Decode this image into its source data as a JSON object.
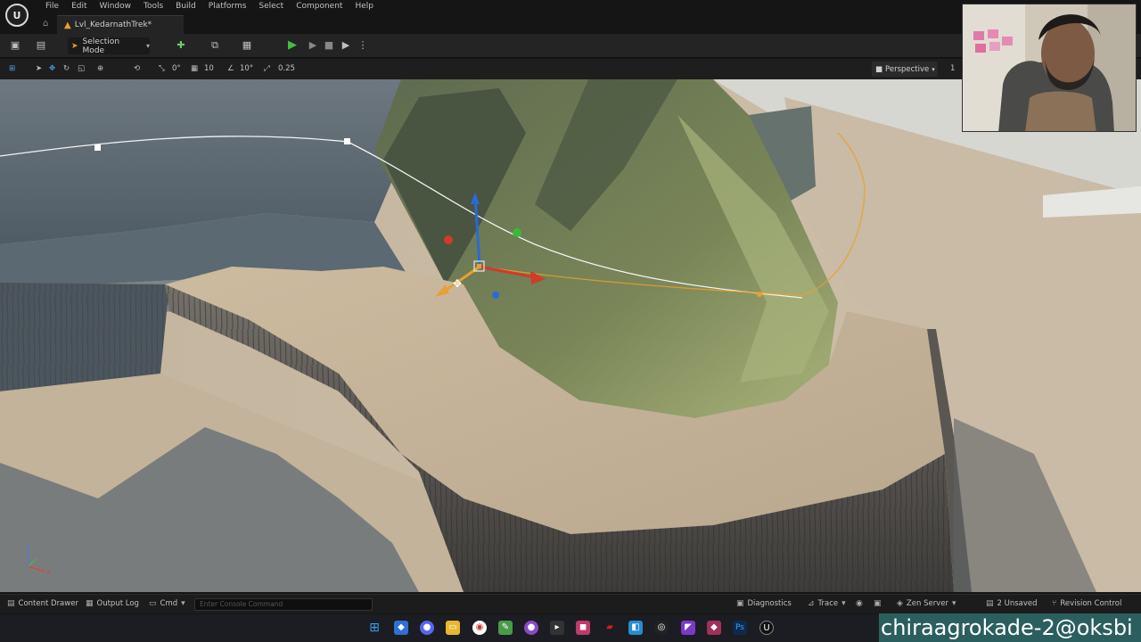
{
  "menubar": {
    "logo": "ue-logo",
    "items": [
      "File",
      "Edit",
      "Window",
      "Tools",
      "Build",
      "Platforms",
      "Select",
      "Component",
      "Help"
    ]
  },
  "tabs": {
    "level_tab": "Lvl_KedarnathTrek*"
  },
  "toolbar": {
    "mode_label": "Selection Mode",
    "icons": [
      "save-icon",
      "content-browser-icon",
      "add-actor-icon",
      "blueprint-icon",
      "cinematics-icon",
      "play-icon",
      "step-icon",
      "stop-icon",
      "launch-icon",
      "more-icon"
    ]
  },
  "viewport_toolbar": {
    "snap_rotation_grid": "0°",
    "grid_size": "10",
    "rotation_snap": "10°",
    "scale_snap": "0.25",
    "perspective_label": "Perspective",
    "fov_label": "1"
  },
  "viewport": {
    "axis_z": "z",
    "axis_x": "x"
  },
  "statusbar": {
    "content_drawer": "Content Drawer",
    "output_log": "Output Log",
    "cmd": "Cmd",
    "console_placeholder": "Enter Console Command",
    "diagnostics": "Diagnostics",
    "trace": "Trace",
    "zen_server": "Zen Server",
    "unsaved": "2 Unsaved",
    "revision_control": "Revision Control"
  },
  "taskbar": {
    "watermark": "chiraagrokade-2@oksbi"
  },
  "colors": {
    "accent_orange": "#e8a030",
    "play_green": "#3ec43e",
    "gizmo_red": "#d23a2a",
    "gizmo_blue": "#2a6ad8",
    "gizmo_green": "#3ab83a",
    "spline_orange": "#e8a030"
  }
}
